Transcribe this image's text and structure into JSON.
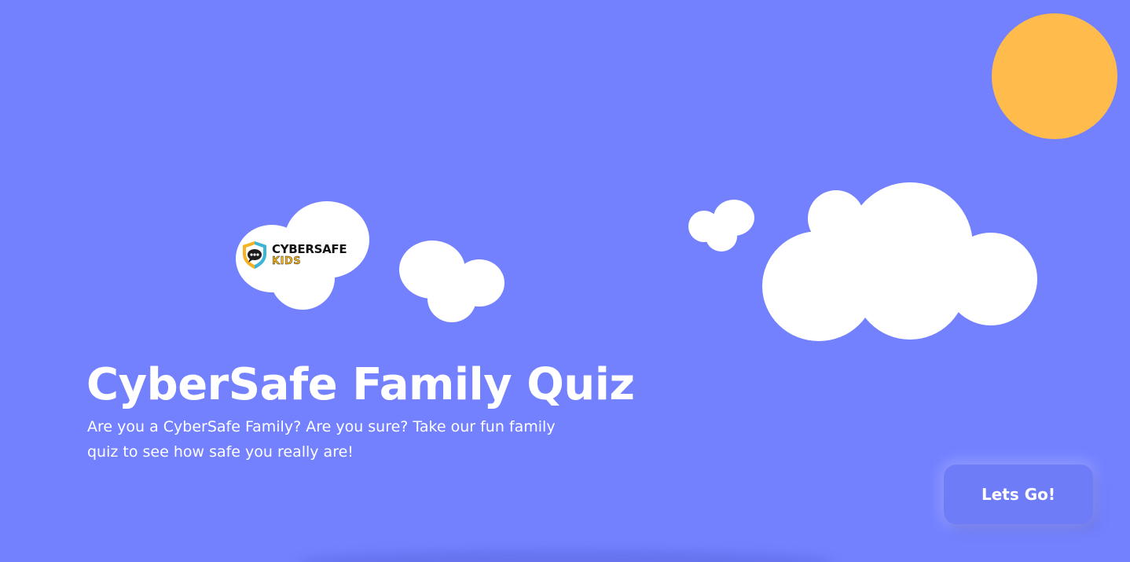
{
  "colors": {
    "sky": "#7381ff",
    "sun": "#ffbb4c",
    "cloud": "#ffffff",
    "button_bg": "#6f7cf7",
    "text": "#ffffff"
  },
  "logo": {
    "line1": "CYBERSAFE",
    "line2": "KIDS",
    "icon": "shield-chat-icon"
  },
  "hero": {
    "title": "CyberSafe Family Quiz",
    "subtitle": "Are you a CyberSafe Family? Are you sure? Take our fun family quiz to see how safe you really are!"
  },
  "cta": {
    "label": "Lets Go!"
  }
}
